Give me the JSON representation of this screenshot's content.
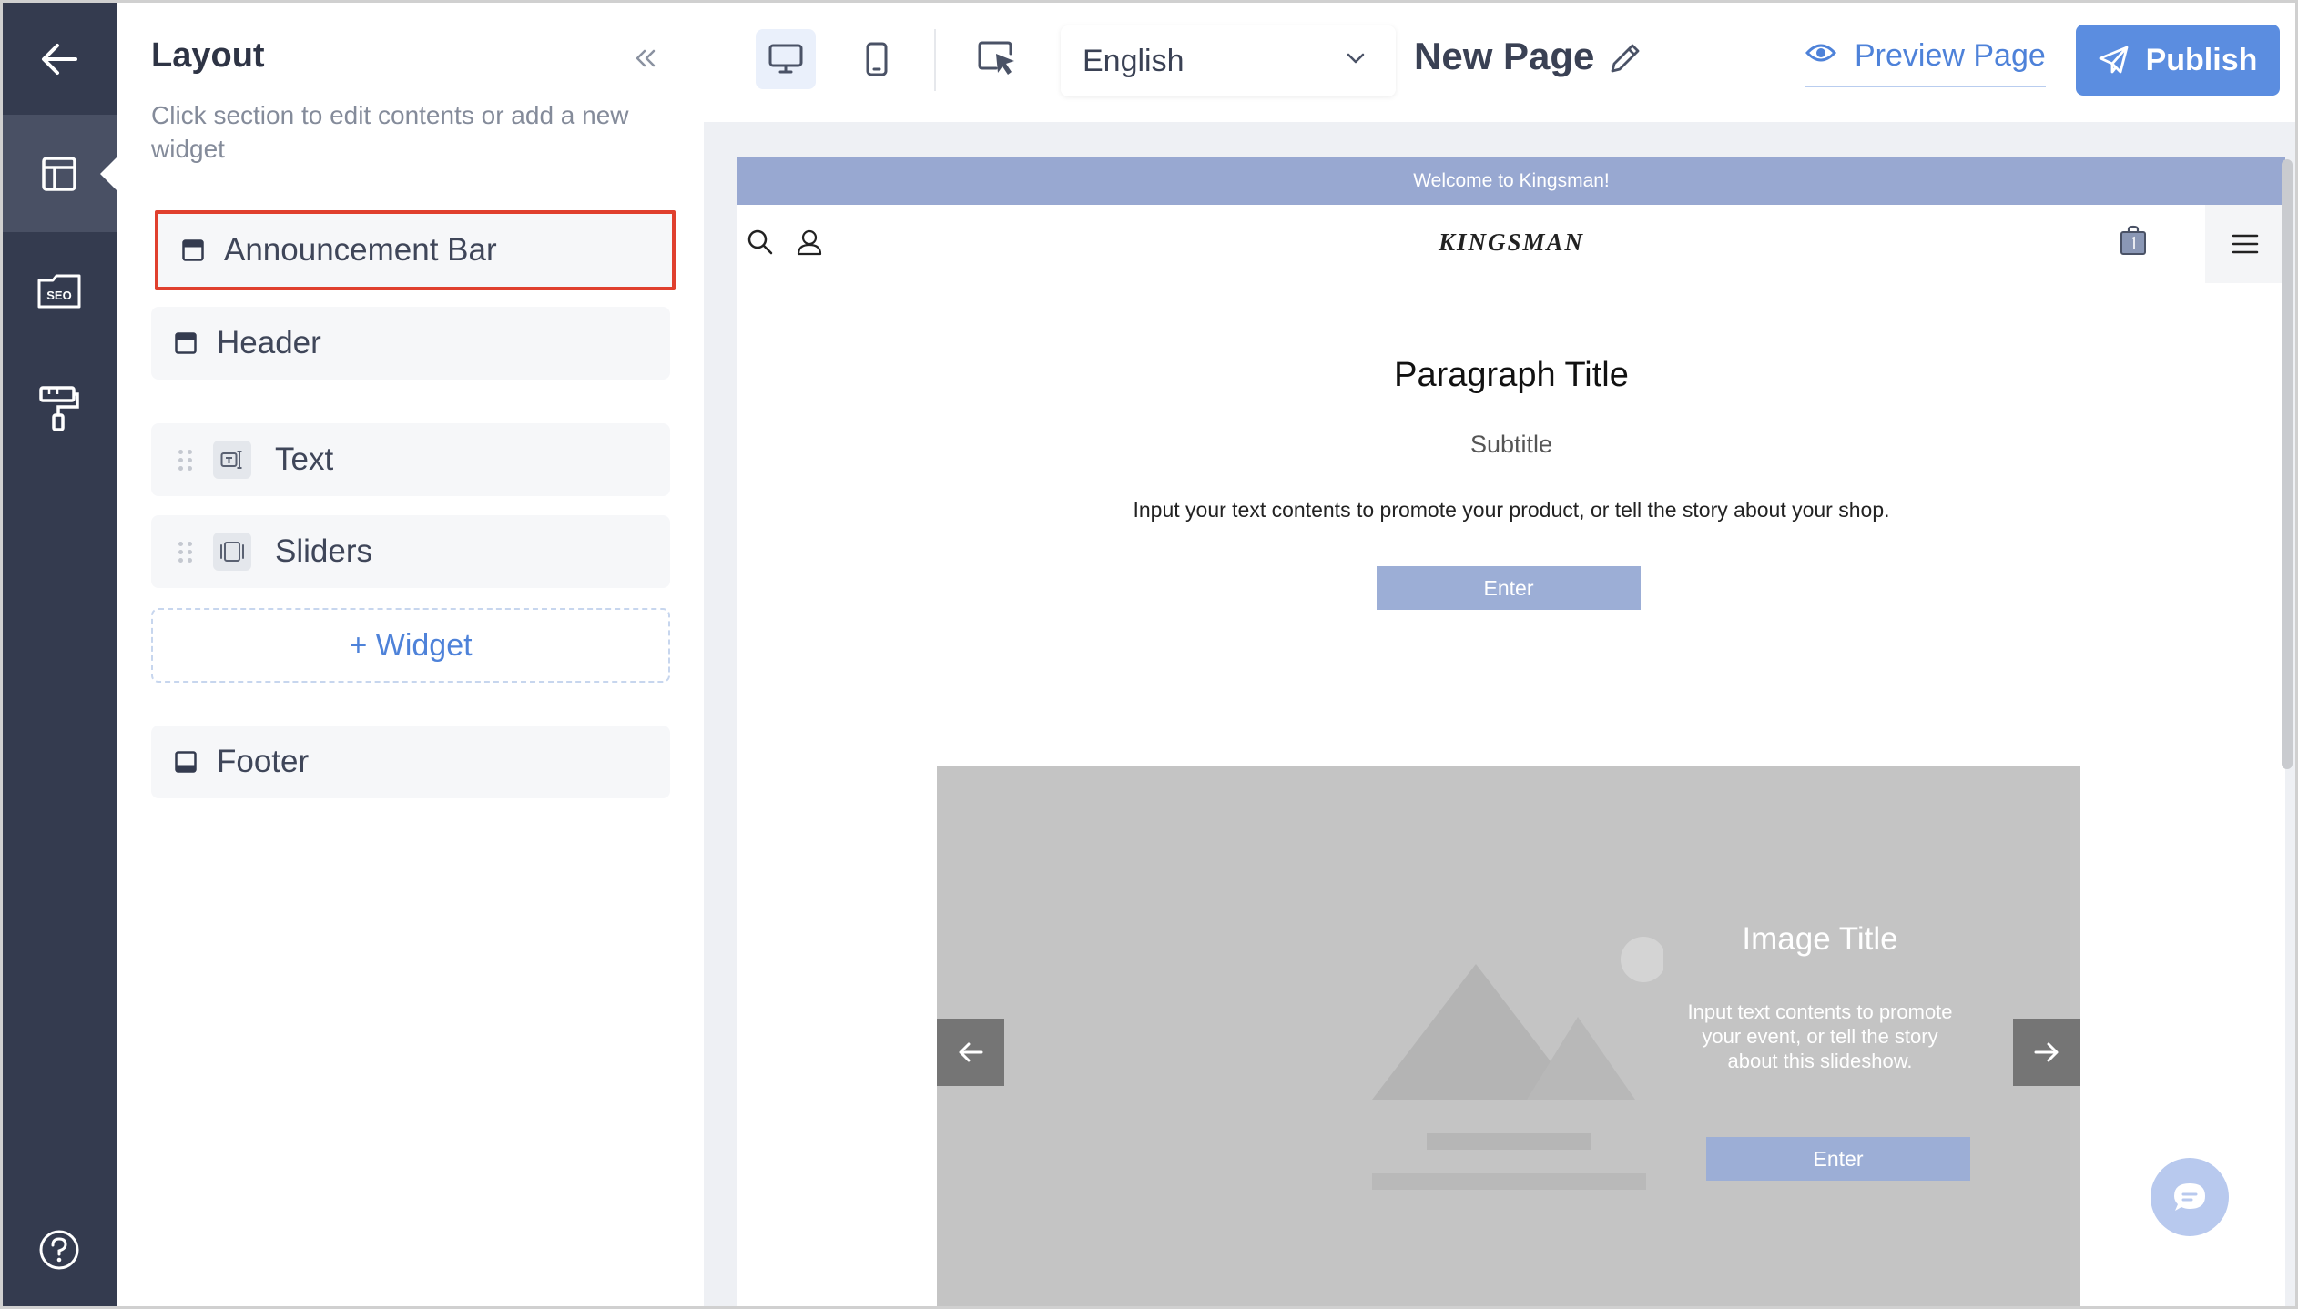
{
  "nav": {
    "items": [
      {
        "name": "back-arrow-icon"
      },
      {
        "name": "layout-icon",
        "active": true
      },
      {
        "name": "seo-icon",
        "badge": "SEO"
      },
      {
        "name": "paint-roller-icon"
      },
      {
        "name": "help-icon"
      }
    ]
  },
  "panel": {
    "title": "Layout",
    "description": "Click section to edit contents or add a new widget",
    "sections": [
      {
        "label": "Announcement Bar",
        "selected": true
      },
      {
        "label": "Header"
      },
      {
        "label": "Text",
        "draggable": true
      },
      {
        "label": "Sliders",
        "draggable": true
      },
      {
        "label": "Footer"
      }
    ],
    "add_widget": "+ Widget"
  },
  "toolbar": {
    "language": "English",
    "page_name": "New Page",
    "preview": "Preview Page",
    "publish": "Publish"
  },
  "site": {
    "announcement": "Welcome to Kingsman!",
    "logo": "KINGSMAN",
    "paragraph_title": "Paragraph Title",
    "subtitle": "Subtitle",
    "body": "Input your text contents to promote your product, or tell the story about your shop.",
    "enter": "Enter",
    "slide": {
      "title": "Image Title",
      "body": "Input text contents to promote your event, or tell the story about this slideshow.",
      "enter": "Enter"
    }
  },
  "colors": {
    "rail": "#343b4f",
    "accent": "#5b8de0",
    "selected_border": "#e0402e",
    "announcement_bg": "#98a8d1"
  }
}
